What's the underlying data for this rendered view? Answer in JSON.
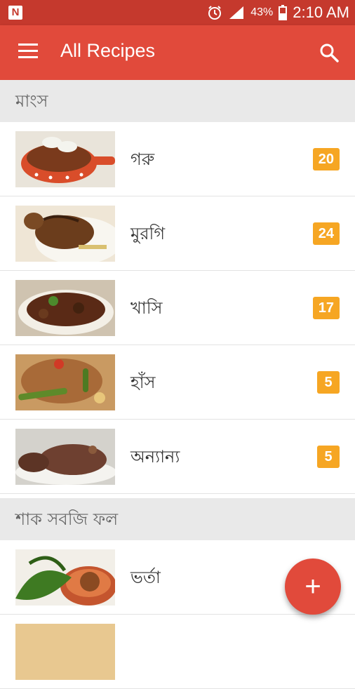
{
  "status_bar": {
    "notification_letter": "N",
    "battery_percent": "43%",
    "time": "2:10 AM"
  },
  "app_bar": {
    "title": "All Recipes"
  },
  "sections": [
    {
      "title": "মাংস",
      "items": [
        {
          "label": "গরু",
          "count": "20",
          "thumb": "beef-curry-image"
        },
        {
          "label": "মুরগি",
          "count": "24",
          "thumb": "roast-chicken-image"
        },
        {
          "label": "খাসি",
          "count": "17",
          "thumb": "mutton-curry-image"
        },
        {
          "label": "হাঁস",
          "count": "5",
          "thumb": "duck-dish-image"
        },
        {
          "label": "অন্যান্য",
          "count": "5",
          "thumb": "other-meat-image"
        }
      ]
    },
    {
      "title": "শাক সবজি ফল",
      "items": [
        {
          "label": "ভর্তা",
          "count": "",
          "thumb": "vorta-image"
        },
        {
          "label": "",
          "count": "",
          "thumb": "partial-row-image"
        }
      ]
    }
  ],
  "fab": {
    "label": "+",
    "icon": "add-icon"
  },
  "colors": {
    "status_bar": "#c5392d",
    "app_bar": "#e14a3b",
    "badge": "#f6a623",
    "section_bg": "#e9e9e9"
  }
}
